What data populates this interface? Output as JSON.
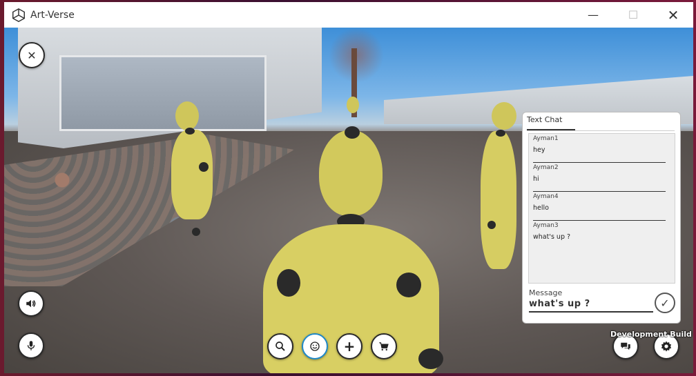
{
  "window": {
    "title": "Art-Verse",
    "controls": {
      "minimize": "—",
      "maximize": "☐",
      "close": "✕"
    }
  },
  "hud": {
    "close_button": {
      "icon": "close-icon",
      "glyph": "✕"
    },
    "speaker_button": {
      "icon": "speaker-icon"
    },
    "mic_button": {
      "icon": "microphone-icon"
    },
    "bottom_toolbar": [
      {
        "name": "search-button",
        "icon": "search-icon"
      },
      {
        "name": "emoji-button",
        "icon": "smiley-icon"
      },
      {
        "name": "add-button",
        "icon": "plus-icon",
        "glyph": "+"
      },
      {
        "name": "cart-button",
        "icon": "cart-icon"
      }
    ],
    "chat_toggle_button": {
      "icon": "chat-bubbles-icon"
    },
    "settings_button": {
      "icon": "gear-icon"
    }
  },
  "chat": {
    "tab_label": "Text Chat",
    "messages": [
      {
        "user": "Ayman1",
        "text": "hey"
      },
      {
        "user": "Ayman2",
        "text": "hi"
      },
      {
        "user": "Ayman4",
        "text": "hello"
      },
      {
        "user": "Ayman3",
        "text": "what's up ?"
      }
    ],
    "message_label": "Message",
    "message_input_value": "what's up ?",
    "send_glyph": "✓"
  },
  "footer": {
    "build_label": "Development Build"
  },
  "colors": {
    "mannequin": "#d6cd62",
    "joint": "#2a2a2a",
    "accent_ring": "#1e88c8"
  }
}
